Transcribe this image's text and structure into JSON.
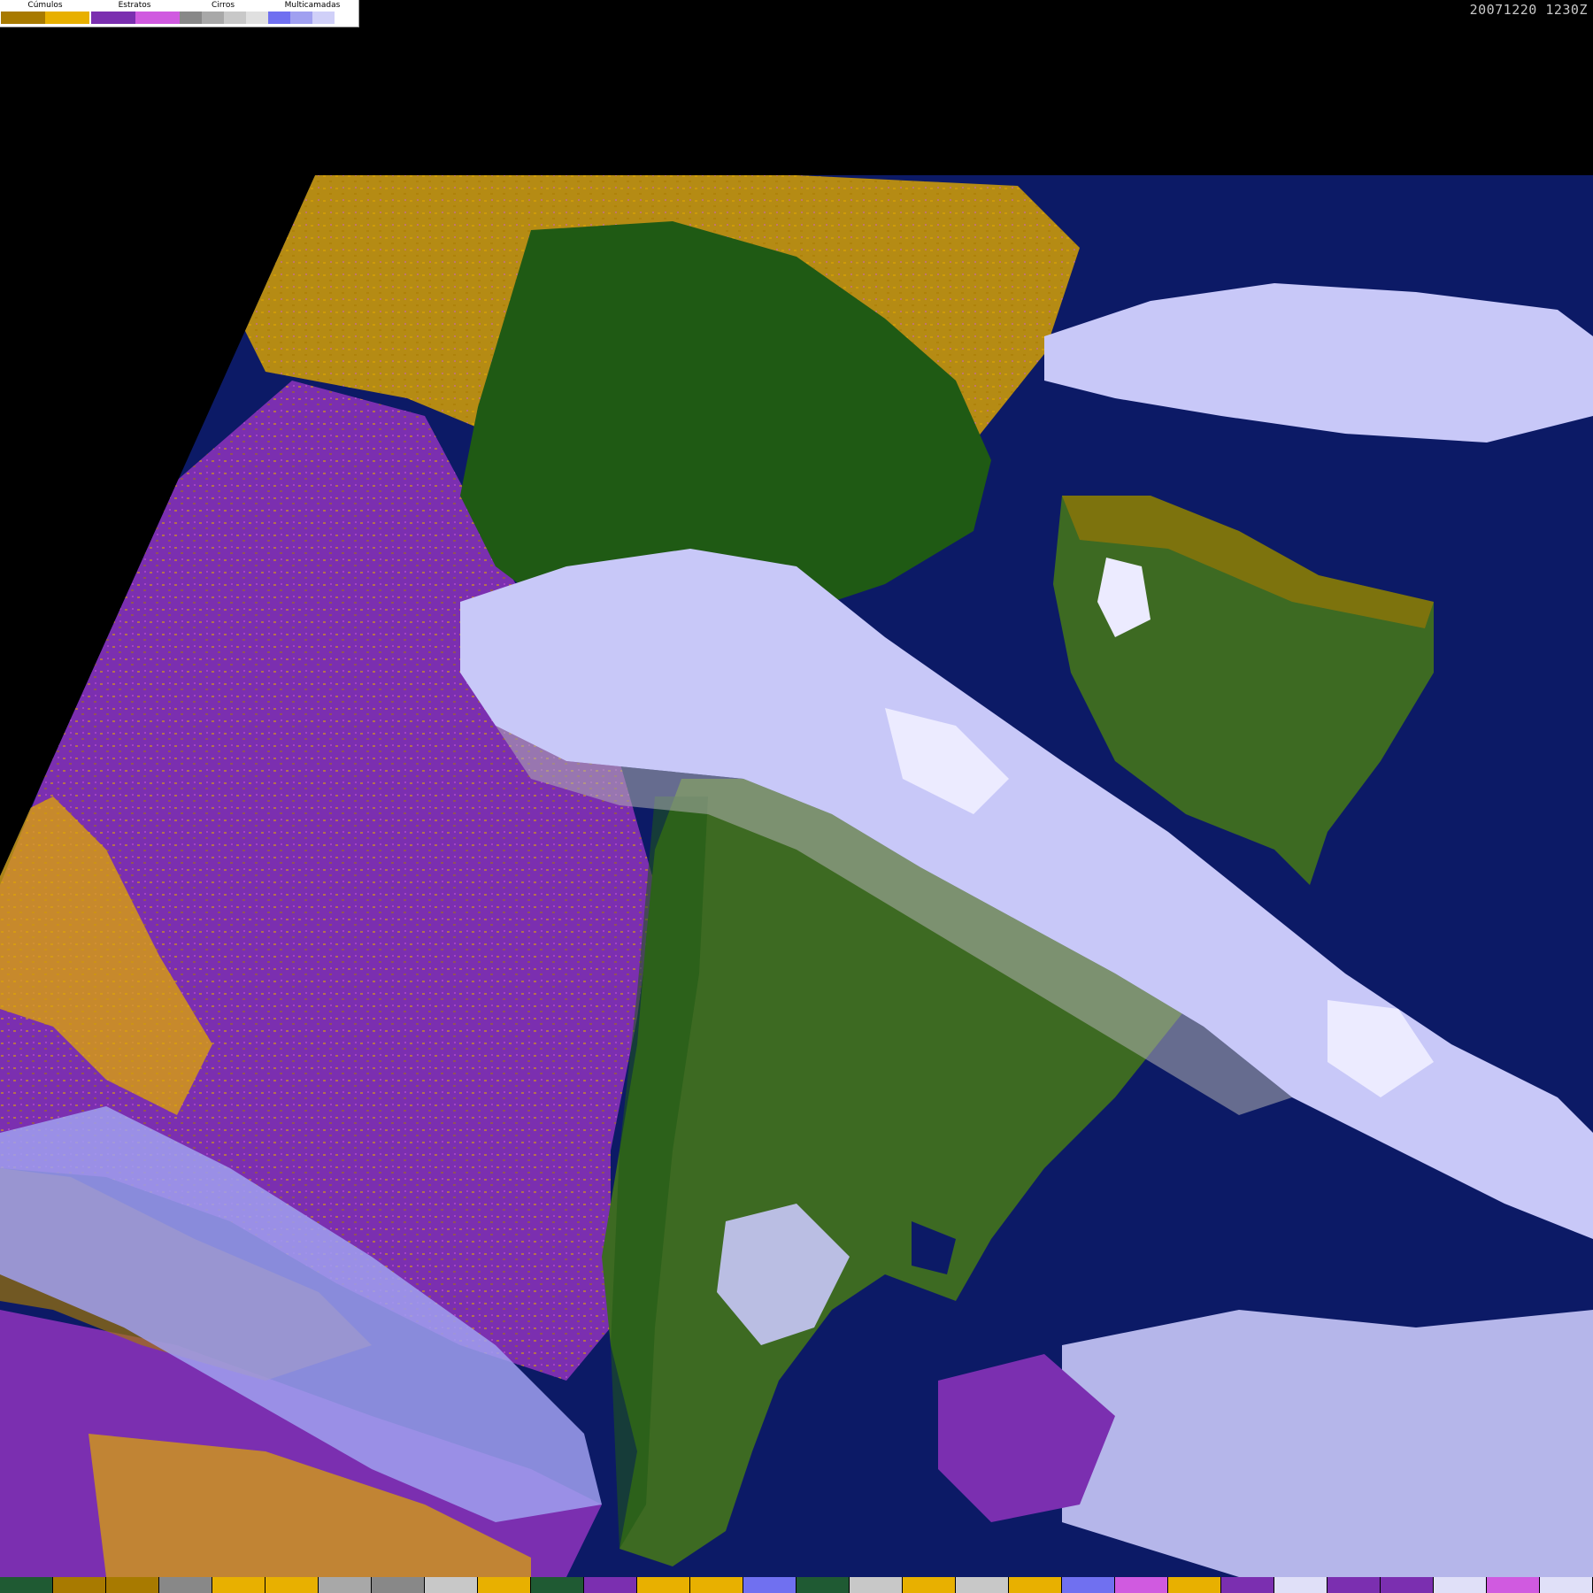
{
  "timestamp": "20071220 1230Z",
  "legend": {
    "groups": [
      {
        "title": "Cúmulos",
        "colors": [
          "#a87a00",
          "#e8b000"
        ]
      },
      {
        "title": "Estratos",
        "colors": [
          "#7b2fb0",
          "#d05ae0"
        ]
      },
      {
        "title": "Cirros",
        "colors": [
          "#888888",
          "#a8a8a8",
          "#c8c8c8",
          "#e0e0e0"
        ]
      },
      {
        "title": "Multicamadas",
        "colors": [
          "#7070f0",
          "#a0a0f0",
          "#d0d0f8",
          "#ffffff"
        ]
      }
    ]
  },
  "map_colors": {
    "ocean": "#0c1a66",
    "land": "#3d6a22",
    "land_dark": "#1f5a14",
    "stratus": "#7b2fb0",
    "cumulus": "#e0a800",
    "cumulus_dark": "#a87a00",
    "multilayer": "#c8c8f8",
    "multilayer_bright": "#ecebff",
    "cirrus": "#b0b0b0"
  },
  "bottom_strip": [
    "#1f5a33",
    "#a87a00",
    "#a87a00",
    "#888888",
    "#e8b000",
    "#e8b000",
    "#a8a8a8",
    "#888888",
    "#c8c8c8",
    "#e8b000",
    "#1f5a33",
    "#7b2fb0",
    "#e8b000",
    "#e8b000",
    "#7070f0",
    "#1f5a33",
    "#c8c8c8",
    "#e8b000",
    "#c8c8c8",
    "#e8b000",
    "#7070f0",
    "#d05ae0",
    "#e8b000",
    "#7b2fb0",
    "#e0e0f8",
    "#7b2fb0",
    "#7b2fb0",
    "#e0e0f8",
    "#d05ae0",
    "#e0e0f8"
  ]
}
